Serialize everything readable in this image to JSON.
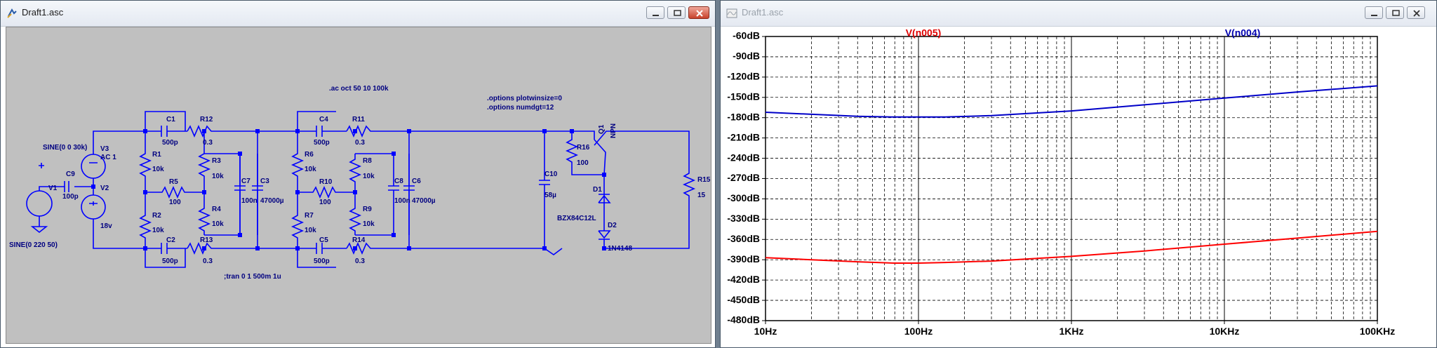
{
  "schematic_window": {
    "title": "Draft1.asc",
    "directives": {
      "ac": ".ac oct 50 10 100k",
      "tran": ";tran 0 1 500m 1u",
      "opt1": ".options plotwinsize=0",
      "opt2": ".options numdgt=12"
    },
    "sources": {
      "v3_spec": "SINE(0 0 30k)",
      "v3_name": "V3",
      "v3_ac": "AC 1",
      "v1_name": "V1",
      "v1_spec": "SINE(0 220 50)",
      "v2_name": "V2",
      "v2_val": "18v"
    },
    "parts": {
      "C9": "C9",
      "C9_val": "100p",
      "C1": "C1",
      "C1_val": "500p",
      "R12": "R12",
      "R12_val": "0.3",
      "R1": "R1",
      "R1_val": "10k",
      "R5": "R5",
      "R5_val": "100",
      "R3": "R3",
      "R3_val": "10k",
      "C7": "C7",
      "C7_val": "100n",
      "C3": "C3",
      "C3_val": "47000µ",
      "R2": "R2",
      "R2_val": "10k",
      "R4": "R4",
      "R4_val": "10k",
      "C2": "C2",
      "C2_val": "500p",
      "R13": "R13",
      "R13_val": "0.3",
      "C4": "C4",
      "C4_val": "500p",
      "R11": "R11",
      "R11_val": "0.3",
      "R6": "R6",
      "R6_val": "10k",
      "R10": "R10",
      "R10_val": "100",
      "R8": "R8",
      "R8_val": "10k",
      "C8": "C8",
      "C8_val": "100n",
      "C6": "C6",
      "C6_val": "47000µ",
      "R7": "R7",
      "R7_val": "10k",
      "R9": "R9",
      "R9_val": "10k",
      "C5": "C5",
      "C5_val": "500p",
      "R14": "R14",
      "R14_val": "0.3",
      "C10": "C10",
      "C10_val": "58µ",
      "R16": "R16",
      "R16_val": "100",
      "Q1": "Q1",
      "Q1_type": "NPN",
      "D1": "D1",
      "D1_type": "BZX84C12L",
      "D2": "D2",
      "D2_type": "1N4148",
      "R15": "R15",
      "R15_val": "15"
    }
  },
  "plot_window": {
    "title": "Draft1.asc",
    "trace_labels": [
      "V(n005)",
      "V(n004)"
    ]
  },
  "chart_data": {
    "type": "line",
    "xscale": "log",
    "xlim": [
      10,
      100000
    ],
    "ylim": [
      -480,
      -60
    ],
    "x_ticks": [
      "10Hz",
      "100Hz",
      "1KHz",
      "10KHz",
      "100KHz"
    ],
    "y_ticks": [
      "-60dB",
      "-90dB",
      "-120dB",
      "-150dB",
      "-180dB",
      "-210dB",
      "-240dB",
      "-270dB",
      "-300dB",
      "-330dB",
      "-360dB",
      "-390dB",
      "-420dB",
      "-450dB",
      "-480dB"
    ],
    "grid": true,
    "series": [
      {
        "name": "V(n005)",
        "color": "#ff0000",
        "x": [
          10,
          20,
          40,
          70,
          100,
          150,
          300,
          1000,
          3000,
          10000,
          30000,
          100000
        ],
        "y": [
          -387,
          -390,
          -393,
          -395,
          -395,
          -394,
          -392,
          -385,
          -377,
          -367,
          -358,
          -348
        ]
      },
      {
        "name": "V(n004)",
        "color": "#0000c8",
        "x": [
          10,
          20,
          40,
          70,
          100,
          150,
          300,
          1000,
          3000,
          10000,
          30000,
          100000
        ],
        "y": [
          -172,
          -175,
          -178,
          -179,
          -179,
          -179,
          -177,
          -170,
          -161,
          -151,
          -142,
          -133
        ]
      }
    ]
  }
}
